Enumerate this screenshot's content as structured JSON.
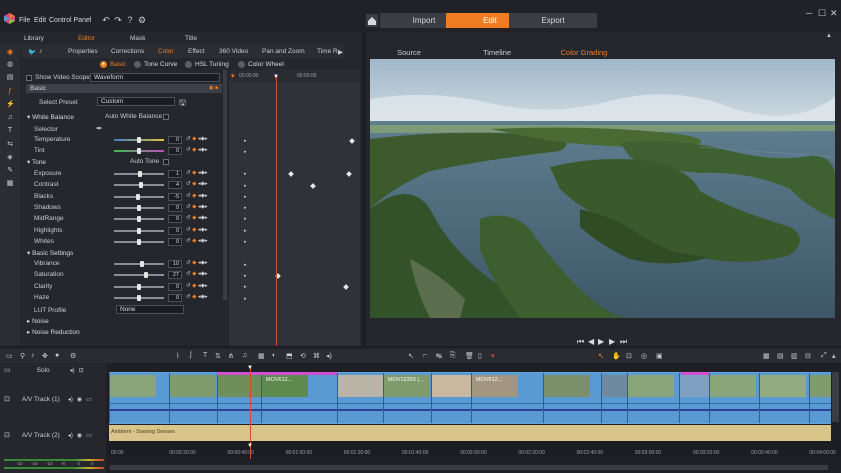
{
  "app": {
    "menu": [
      "File",
      "Edit",
      "Control Panel"
    ],
    "top_buttons": [
      "Import",
      "Edit",
      "Export"
    ],
    "active_top_button": "Edit",
    "accent_color": "#f07d21"
  },
  "left_panel": {
    "tabs": [
      "Library",
      "Editor",
      "Mask",
      "Title"
    ],
    "active_tab": "Editor",
    "effect_tabs": [
      "Properties",
      "Corrections",
      "Color",
      "Effect",
      "360 Video",
      "Pan and Zoom",
      "Time R"
    ],
    "active_effect_tab": "Color",
    "sub_tabs": [
      "Basic",
      "Tone Curve",
      "HSL Tuning",
      "Color Wheel"
    ],
    "active_sub_tab": "Basic",
    "show_video_scope_label": "Show Video Scope",
    "scope_value": "Waveform",
    "basic_header": "Basic",
    "select_preset_label": "Select Preset",
    "preset_value": "Custom",
    "white_balance": {
      "title": "White Balance",
      "auto_label": "Auto White Balance",
      "selector_label": "Selector",
      "rows": [
        {
          "label": "Temperature",
          "value": "0",
          "level": 0.5
        },
        {
          "label": "Tint",
          "value": "0",
          "level": 0.5
        }
      ]
    },
    "tone": {
      "title": "Tone",
      "auto_label": "Auto Tone",
      "rows": [
        {
          "label": "Exposure",
          "value": "1",
          "level": 0.52
        },
        {
          "label": "Contrast",
          "value": "4",
          "level": 0.54
        },
        {
          "label": "Blacks",
          "value": "-5",
          "level": 0.47
        },
        {
          "label": "Shadows",
          "value": "0",
          "level": 0.5
        },
        {
          "label": "MidRange",
          "value": "0",
          "level": 0.5
        },
        {
          "label": "Highlights",
          "value": "0",
          "level": 0.5
        },
        {
          "label": "Whites",
          "value": "0",
          "level": 0.5
        }
      ]
    },
    "basic_settings": {
      "title": "Basic Settings",
      "rows": [
        {
          "label": "Vibrance",
          "value": "10",
          "level": 0.55
        },
        {
          "label": "Saturation",
          "value": "27",
          "level": 0.63
        },
        {
          "label": "Clarity",
          "value": "0",
          "level": 0.5
        },
        {
          "label": "Haze",
          "value": "0",
          "level": 0.5
        }
      ]
    },
    "lut_label": "LUT Profile",
    "lut_value": "None",
    "collapsed_sections": [
      "Noise",
      "Noise Reduction"
    ],
    "kf_ruler": [
      "00:00:00",
      "00:00:00"
    ]
  },
  "preview": {
    "tabs": [
      "Source",
      "Timeline",
      "Color Grading"
    ],
    "active_tab": "Color Grading"
  },
  "timeline": {
    "tracks": [
      {
        "name": "Solo"
      },
      {
        "name": "A/V Track (1)"
      },
      {
        "name": "A/V Track (2)"
      }
    ],
    "clips": [
      {
        "label": "MOV612..."
      },
      {
        "label": "MOV12353 (..."
      },
      {
        "label": "MOV612..."
      }
    ],
    "audio_clip_label": "Ambient - Soaring Senses",
    "ruler_labels": [
      "00:00",
      "00:00:20:00",
      "00:00:40:00",
      "00:01:00:00",
      "00:01:20:00",
      "00:01:40:00",
      "00:02:00:00",
      "00:02:20:00",
      "00:02:40:00",
      "00:03:00:00",
      "00:03:20:00",
      "00:03:40:00",
      "00:04:00:00"
    ],
    "meter_labels": [
      "-22",
      "-16",
      "-10",
      "-6",
      "-3",
      "0"
    ]
  }
}
